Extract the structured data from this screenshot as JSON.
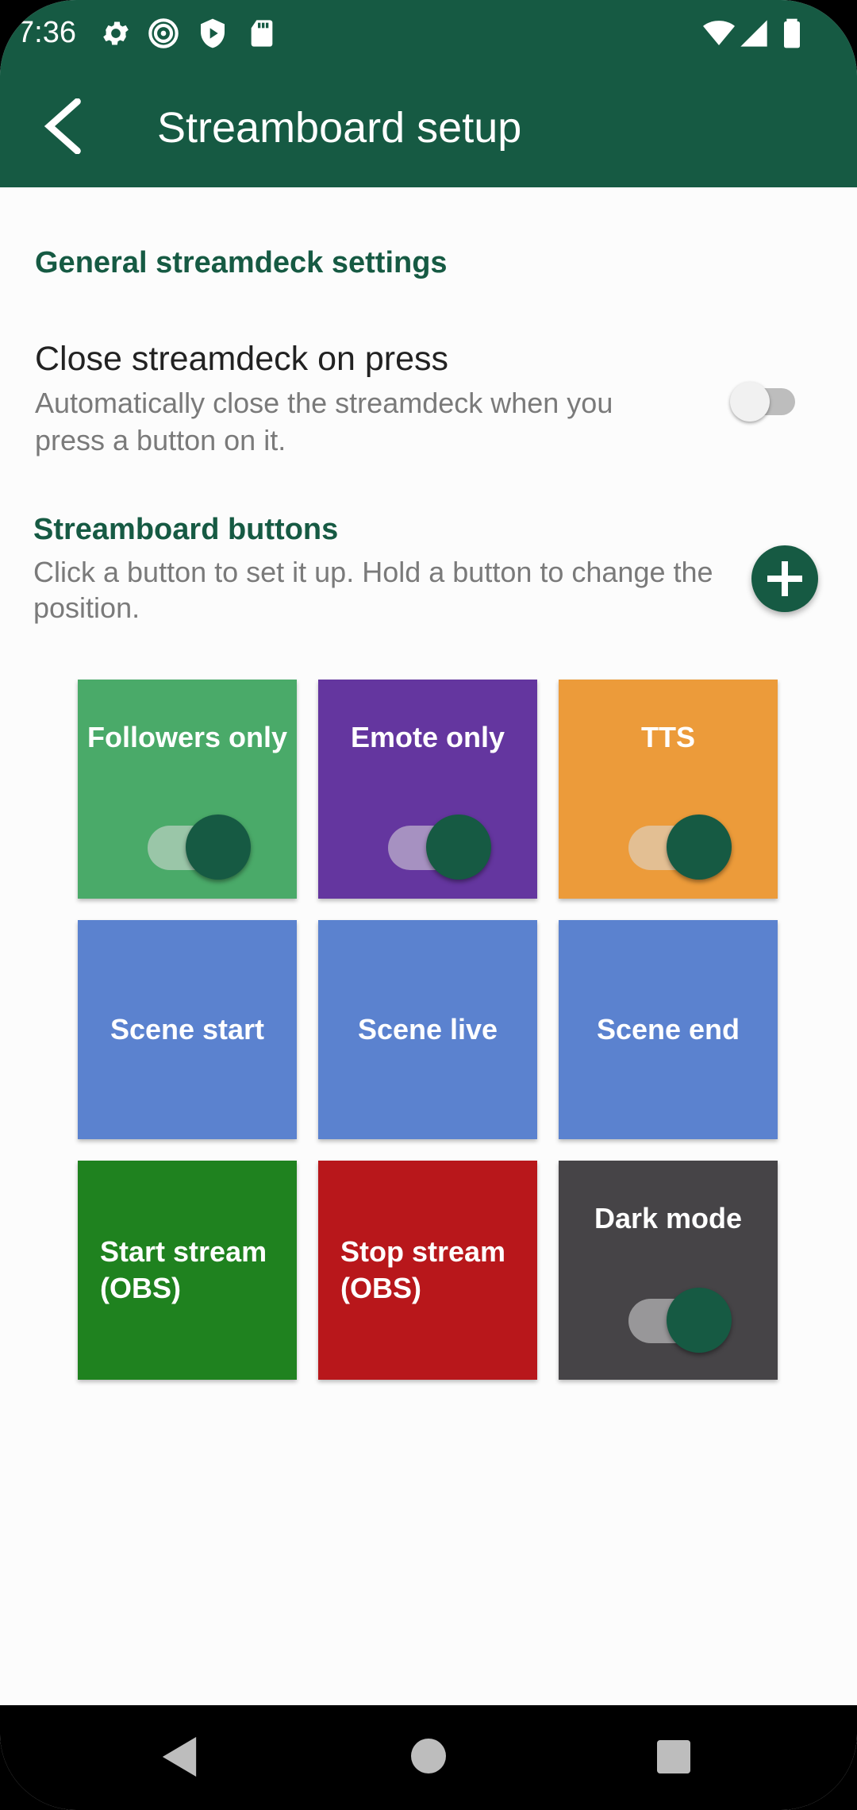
{
  "status_bar": {
    "time": "7:36",
    "icons": [
      "gear-icon",
      "spiral-icon",
      "shield-play-icon",
      "sdcard-icon",
      "wifi-icon",
      "signal-icon",
      "battery-icon"
    ]
  },
  "app_bar": {
    "title": "Streamboard setup",
    "back_icon": "back-arrow-icon",
    "color": "#165a43"
  },
  "general": {
    "section_title": "General streamdeck settings",
    "close_on_press": {
      "title": "Close streamdeck on press",
      "summary": "Automatically close the streamdeck when you press a button on it.",
      "enabled": false
    }
  },
  "buttons_section": {
    "title": "Streamboard buttons",
    "help": "Click a button to set it up. Hold a button to change the position.",
    "add_icon": "plus-icon"
  },
  "tiles": [
    {
      "label": "Followers only",
      "color": "#4aaa69",
      "toggle": true
    },
    {
      "label": "Emote only",
      "color": "#64369f",
      "toggle": true
    },
    {
      "label": "TTS",
      "color": "#ec9b3a",
      "toggle": true
    },
    {
      "label": "Scene start",
      "color": "#5b82cf",
      "toggle": false
    },
    {
      "label": "Scene live",
      "color": "#5b82cf",
      "toggle": false
    },
    {
      "label": "Scene end",
      "color": "#5b82cf",
      "toggle": false
    },
    {
      "label": "Start stream (OBS)",
      "color": "#1f821f",
      "toggle": false
    },
    {
      "label": "Stop stream (OBS)",
      "color": "#b8171b",
      "toggle": false
    },
    {
      "label": "Dark mode",
      "color": "#464447",
      "toggle": true
    }
  ],
  "nav_bar": {
    "icons": [
      "nav-back-icon",
      "nav-home-icon",
      "nav-recents-icon"
    ]
  }
}
